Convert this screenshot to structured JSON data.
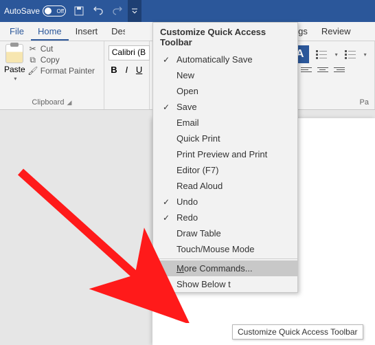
{
  "titlebar": {
    "autosave_label": "AutoSave",
    "autosave_state": "Off"
  },
  "tabs": {
    "file": "File",
    "home": "Home",
    "insert": "Insert",
    "design": "Desi",
    "mailings": "Mailings",
    "review": "Review"
  },
  "clipboard": {
    "paste": "Paste",
    "cut": "Cut",
    "copy": "Copy",
    "format_painter": "Format Painter",
    "group_label": "Clipboard"
  },
  "font": {
    "name": "Calibri (B",
    "bold": "B",
    "italic": "I",
    "underline": "U"
  },
  "paragraph": {
    "group_label_right": "Pa"
  },
  "dropdown": {
    "title": "Customize Quick Access Toolbar",
    "items": [
      {
        "label": "Automatically Save",
        "checked": true
      },
      {
        "label": "New",
        "checked": false
      },
      {
        "label": "Open",
        "checked": false
      },
      {
        "label": "Save",
        "checked": true
      },
      {
        "label": "Email",
        "checked": false
      },
      {
        "label": "Quick Print",
        "checked": false
      },
      {
        "label": "Print Preview and Print",
        "checked": false
      },
      {
        "label": "Editor (F7)",
        "checked": false
      },
      {
        "label": "Read Aloud",
        "checked": false
      },
      {
        "label": "Undo",
        "checked": true
      },
      {
        "label": "Redo",
        "checked": true
      },
      {
        "label": "Draw Table",
        "checked": false
      },
      {
        "label": "Touch/Mouse Mode",
        "checked": false
      }
    ],
    "more_commands_pre": "M",
    "more_commands_post": "ore Commands...",
    "show_below": "Show Below t"
  },
  "tooltip": "Customize Quick Access Toolbar"
}
